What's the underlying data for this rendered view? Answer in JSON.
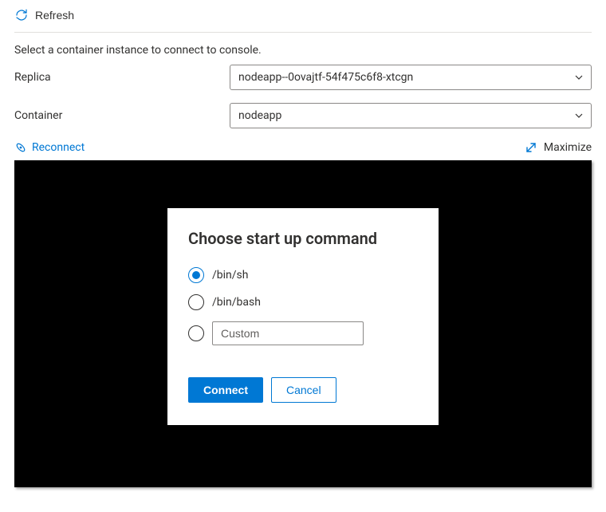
{
  "toolbar": {
    "refresh_label": "Refresh"
  },
  "instruction_text": "Select a container instance to connect to console.",
  "fields": {
    "replica": {
      "label": "Replica",
      "value": "nodeapp--0ovajtf-54f475c6f8-xtcgn"
    },
    "container": {
      "label": "Container",
      "value": "nodeapp"
    }
  },
  "console_toolbar": {
    "reconnect_label": "Reconnect",
    "maximize_label": "Maximize"
  },
  "dialog": {
    "title": "Choose start up command",
    "options": {
      "sh": "/bin/sh",
      "bash": "/bin/bash",
      "custom_placeholder": "Custom"
    },
    "selected": "sh",
    "actions": {
      "connect": "Connect",
      "cancel": "Cancel"
    }
  },
  "colors": {
    "accent": "#0078d4",
    "text": "#323130",
    "border": "#8a8886"
  }
}
